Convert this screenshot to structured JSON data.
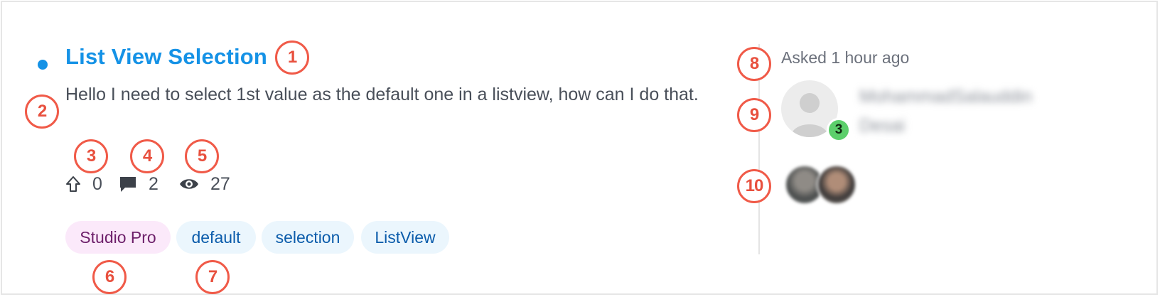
{
  "question": {
    "title": "List View Selection",
    "body": "Hello I need to select 1st value as the default one in a listview, how can I do that.",
    "stats": {
      "votes": "0",
      "comments": "2",
      "views": "27"
    },
    "tags": [
      {
        "label": "Studio Pro",
        "kind": "product"
      },
      {
        "label": "default",
        "kind": "topic"
      },
      {
        "label": "selection",
        "kind": "topic"
      },
      {
        "label": "ListView",
        "kind": "topic"
      }
    ]
  },
  "meta": {
    "asked": "Asked 1 hour ago",
    "author_name": "MohammadSalauddin Desai",
    "author_reputation": "3"
  },
  "callouts": [
    "1",
    "2",
    "3",
    "4",
    "5",
    "6",
    "7",
    "8",
    "9",
    "10"
  ],
  "icons": {
    "unread": "dot-icon",
    "votes": "upvote-arrow-icon",
    "comments": "comment-bubble-icon",
    "views": "eye-icon",
    "avatar": "user-placeholder-icon"
  },
  "colors": {
    "accent": "#1592e6",
    "callout": "#f05a48",
    "reputation_badge": "#5ccf6b",
    "product_tag_bg": "#fbe9fa",
    "topic_tag_bg": "#ebf6fd"
  }
}
